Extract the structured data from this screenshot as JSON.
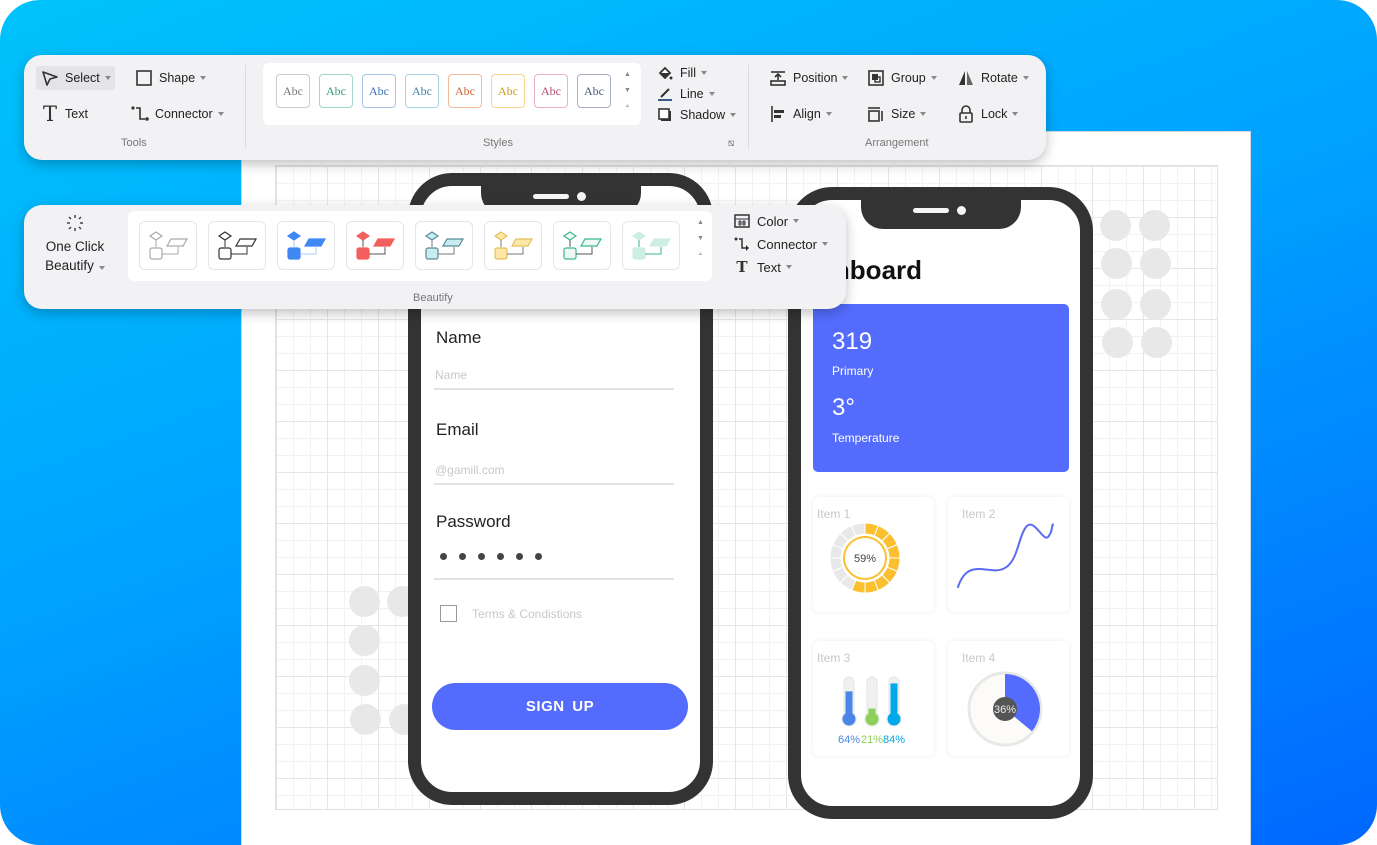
{
  "colors": {
    "accent": "#546cfe",
    "phone_frame": "#333333",
    "donut_yellow": "#fbbf2f",
    "thermo_blue": "#4a86e8",
    "thermo_green": "#8dd05a",
    "thermo_cyan": "#00a8ec"
  },
  "toolbar": {
    "tools": {
      "select": "Select",
      "shape": "Shape",
      "text": "Text",
      "connector": "Connector",
      "group_label": "Tools"
    },
    "styles": {
      "swatches": [
        {
          "label": "Abc",
          "color": "#777777",
          "border": "#cccccc"
        },
        {
          "label": "Abc",
          "color": "#2f9e79",
          "border": "#9fd8c4"
        },
        {
          "label": "Abc",
          "color": "#3b6fb6",
          "border": "#a9c4e6"
        },
        {
          "label": "Abc",
          "color": "#3b84a8",
          "border": "#a7d2e6"
        },
        {
          "label": "Abc",
          "color": "#c8642f",
          "border": "#f0b99a"
        },
        {
          "label": "Abc",
          "color": "#d39d14",
          "border": "#f5d590"
        },
        {
          "label": "Abc",
          "color": "#b64a6e",
          "border": "#ebb0c3"
        },
        {
          "label": "Abc",
          "color": "#4a5a7a",
          "border": "#a8b0c4"
        }
      ],
      "fill": "Fill",
      "line": "Line",
      "shadow": "Shadow",
      "group_label": "Styles"
    },
    "arrangement": {
      "position": "Position",
      "group": "Group",
      "rotate": "Rotate",
      "align": "Align",
      "size": "Size",
      "lock": "Lock",
      "group_label": "Arrangement"
    }
  },
  "beautify": {
    "one_click_line1": "One Click",
    "one_click_line2": "Beautify",
    "swatches": [
      {
        "name": "outline-light",
        "fill": "#ffffff",
        "stroke": "#aaaaaa",
        "link": "#aaaaaa"
      },
      {
        "name": "outline-dark",
        "fill": "#ffffff",
        "stroke": "#333333",
        "link": "#333333"
      },
      {
        "name": "blue",
        "fill": "#3f87f5",
        "stroke": "#3f87f5",
        "link": "#a9c8f5"
      },
      {
        "name": "red",
        "fill": "#f25f5c",
        "stroke": "#f25f5c",
        "link": "#555555"
      },
      {
        "name": "light-cyan",
        "fill": "#c9ecf2",
        "stroke": "#5a8a96",
        "link": "#777777"
      },
      {
        "name": "yellow",
        "fill": "#fde7a8",
        "stroke": "#e2c15c",
        "link": "#777777"
      },
      {
        "name": "mint-outline",
        "fill": "#eef8f4",
        "stroke": "#3bb98a",
        "link": "#555555"
      },
      {
        "name": "mint-soft",
        "fill": "#cdeee2",
        "stroke": "#cdeee2",
        "link": "#3bb98a"
      }
    ],
    "color": "Color",
    "connector": "Connector",
    "text": "Text",
    "group_label": "Beautify"
  },
  "signup_screen": {
    "name_label": "Name",
    "name_placeholder": "Name",
    "email_label": "Email",
    "email_placeholder": "@gamill.com",
    "password_label": "Password",
    "password_length": 6,
    "terms": "Terms & Condistions",
    "signup_button": "SIGN  UP"
  },
  "dashboard_screen": {
    "title": "ashboard",
    "primary_value": "319",
    "primary_label": "Primary",
    "temperature_value": "3°",
    "temperature_label": "Temperature",
    "item1": {
      "label": "Item 1",
      "percent": 59,
      "text": "59%"
    },
    "item2": {
      "label": "Item 2"
    },
    "item3": {
      "label": "Item 3",
      "thermometers": [
        {
          "percent": 64,
          "text": "64%",
          "color": "#4a86e8"
        },
        {
          "percent": 21,
          "text": "21%",
          "color": "#8dd05a"
        },
        {
          "percent": 84,
          "text": "84%",
          "color": "#00a8ec"
        }
      ]
    },
    "item4": {
      "label": "Item 4",
      "percent": 36,
      "text": "36%"
    }
  }
}
